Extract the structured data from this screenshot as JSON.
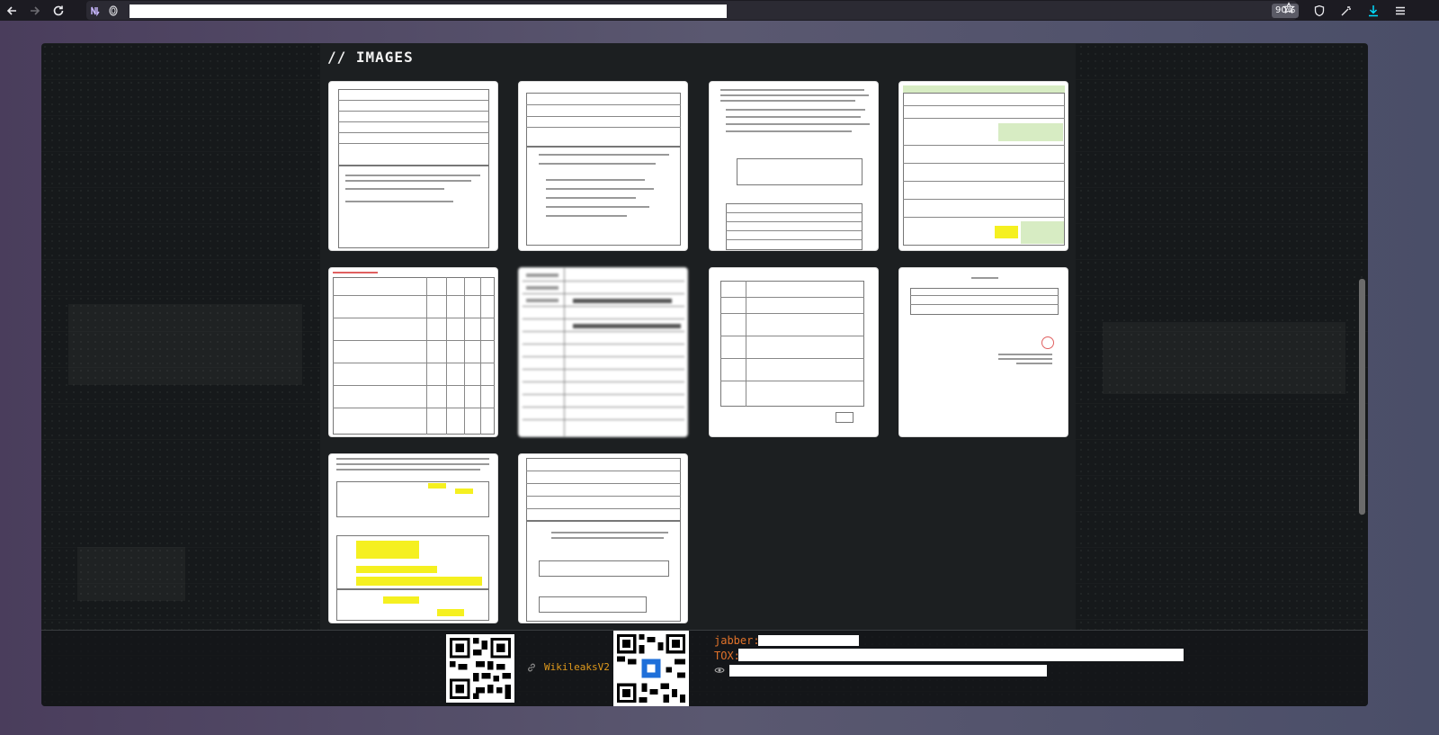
{
  "browser": {
    "zoom": "90%",
    "icons": [
      "back-icon",
      "forward-icon",
      "reload-icon",
      "extension-icon",
      "fingerprint-icon",
      "bookmark-star-icon",
      "shield-icon",
      "customize-icon",
      "download-icon",
      "menu-icon"
    ]
  },
  "page": {
    "section_title": "// IMAGES"
  },
  "footer": {
    "link_label": "WikileaksV2",
    "jabber_label": "jabber:",
    "tox_label": "TOX:"
  },
  "colors": {
    "panel_bg": "#16191b",
    "accent_orange": "#e0722a",
    "link_orange": "#e09a1c"
  }
}
